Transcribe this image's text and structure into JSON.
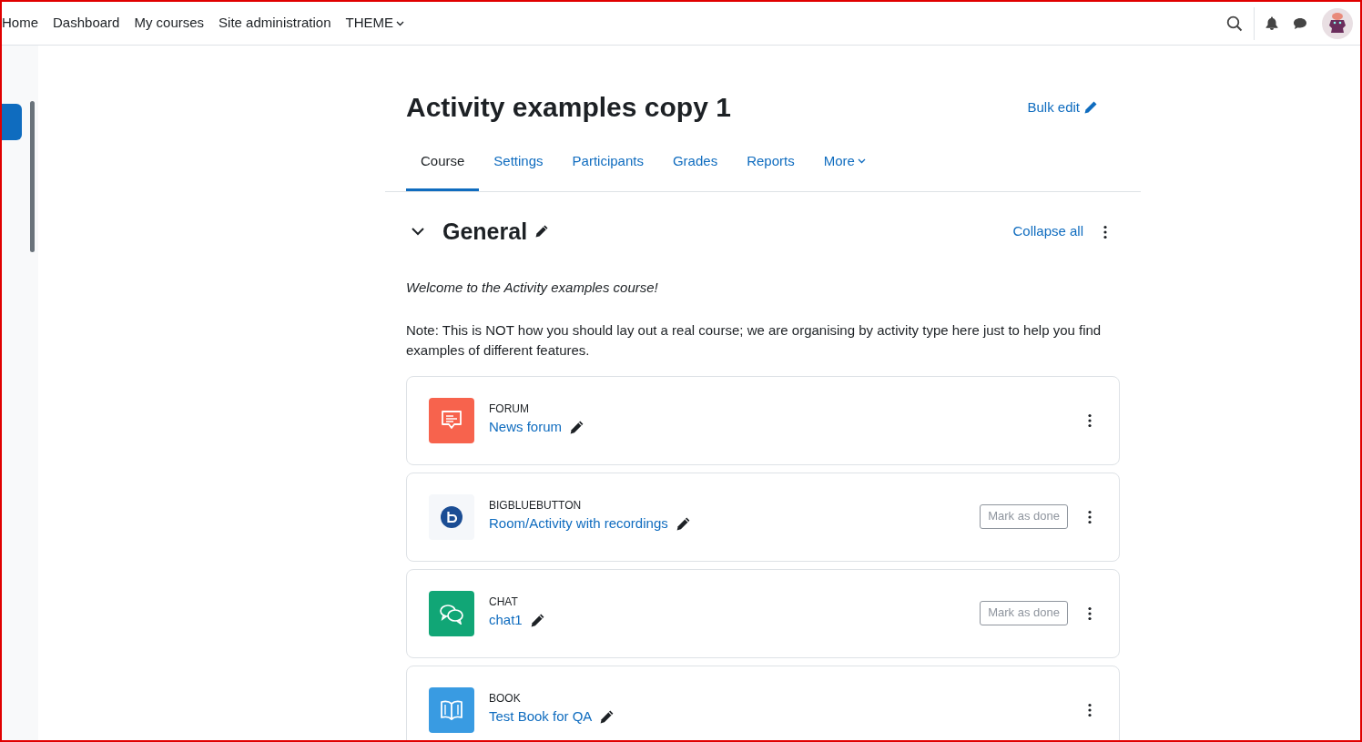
{
  "navbar": {
    "items": [
      {
        "label": "Home",
        "dropdown": false
      },
      {
        "label": "Dashboard",
        "dropdown": false
      },
      {
        "label": "My courses",
        "dropdown": false
      },
      {
        "label": "Site administration",
        "dropdown": false
      },
      {
        "label": "THEME",
        "dropdown": true
      }
    ]
  },
  "course": {
    "title": "Activity examples copy 1",
    "bulk_edit": "Bulk edit"
  },
  "tabs": [
    {
      "label": "Course",
      "selected": true,
      "dropdown": false
    },
    {
      "label": "Settings",
      "selected": false,
      "dropdown": false
    },
    {
      "label": "Participants",
      "selected": false,
      "dropdown": false
    },
    {
      "label": "Grades",
      "selected": false,
      "dropdown": false
    },
    {
      "label": "Reports",
      "selected": false,
      "dropdown": false
    },
    {
      "label": "More",
      "selected": false,
      "dropdown": true
    }
  ],
  "section": {
    "title": "General",
    "expanded": true,
    "collapse_all": "Collapse all",
    "intro": "Welcome to the Activity examples course!",
    "note": "Note: This is NOT how you should lay out a real course; we are organising by activity type here just to help you find examples of different features."
  },
  "activities": [
    {
      "kind": "forum",
      "type": "FORUM",
      "name": "News forum",
      "color": "#f7634d"
    },
    {
      "kind": "bigbluebutton",
      "type": "BIGBLUEBUTTON",
      "name": "Room/Activity with recordings",
      "color": "#f5f7fa",
      "completion": "Mark as done"
    },
    {
      "kind": "chat",
      "type": "CHAT",
      "name": "chat1",
      "color": "#11a676",
      "completion": "Mark as done"
    },
    {
      "kind": "book",
      "type": "BOOK",
      "name": "Test Book for QA",
      "color": "#399be2"
    }
  ]
}
